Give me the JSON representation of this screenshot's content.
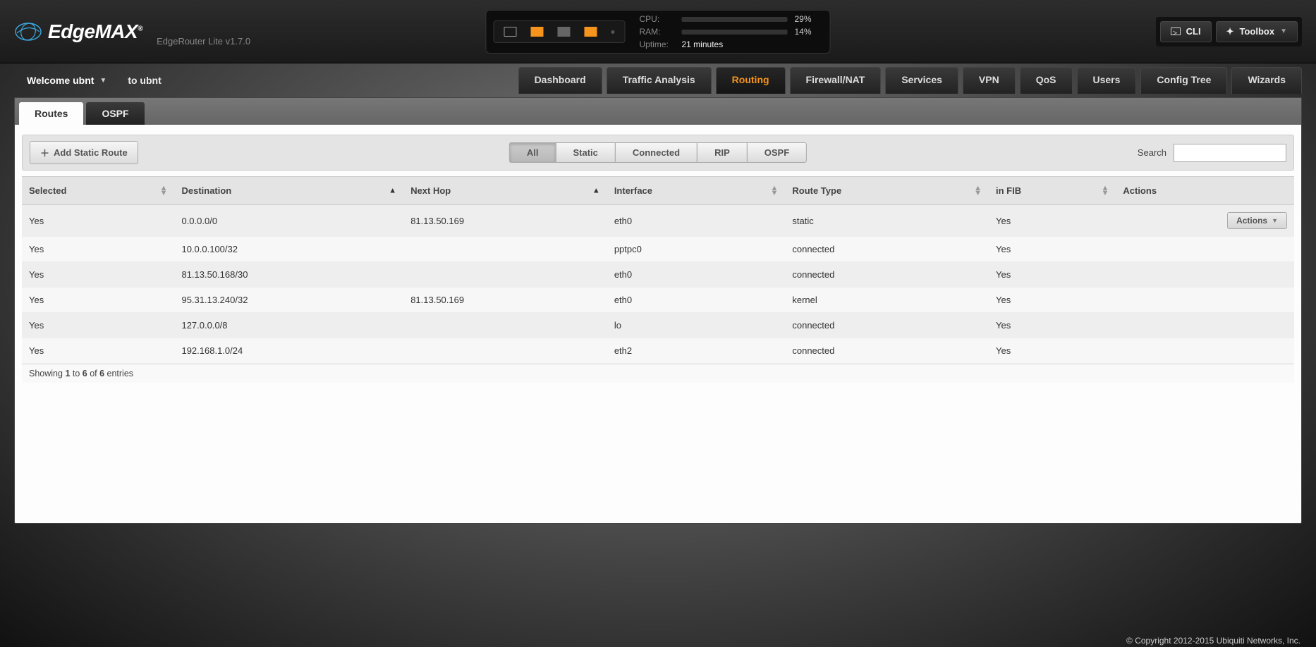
{
  "brand": {
    "name_a": "Edge",
    "name_b": "MAX",
    "subtitle": "EdgeRouter Lite v1.7.0"
  },
  "status_panel": {
    "cpu_label": "CPU:",
    "cpu_pct": 29,
    "cpu_text": "29%",
    "ram_label": "RAM:",
    "ram_pct": 14,
    "ram_text": "14%",
    "uptime_label": "Uptime:",
    "uptime_value": "21 minutes"
  },
  "header_buttons": {
    "cli": "CLI",
    "toolbox": "Toolbox"
  },
  "welcome": {
    "text": "Welcome ubnt",
    "to": "to ubnt"
  },
  "main_tabs": [
    "Dashboard",
    "Traffic Analysis",
    "Routing",
    "Firewall/NAT",
    "Services",
    "VPN",
    "QoS",
    "Users",
    "Config Tree",
    "Wizards"
  ],
  "main_tab_active": "Routing",
  "sub_tabs": [
    "Routes",
    "OSPF"
  ],
  "sub_tab_active": "Routes",
  "toolbar": {
    "add_route": "Add Static Route",
    "filters": [
      "All",
      "Static",
      "Connected",
      "RIP",
      "OSPF"
    ],
    "filter_active": "All",
    "search_label": "Search"
  },
  "columns": {
    "selected": "Selected",
    "destination": "Destination",
    "next_hop": "Next Hop",
    "interface": "Interface",
    "route_type": "Route Type",
    "in_fib": "in FIB",
    "actions": "Actions"
  },
  "rows": [
    {
      "selected": "Yes",
      "destination": "0.0.0.0/0",
      "next_hop": "81.13.50.169",
      "interface": "eth0",
      "route_type": "static",
      "in_fib": "Yes",
      "has_actions": true
    },
    {
      "selected": "Yes",
      "destination": "10.0.0.100/32",
      "next_hop": "",
      "interface": "pptpc0",
      "route_type": "connected",
      "in_fib": "Yes",
      "has_actions": false
    },
    {
      "selected": "Yes",
      "destination": "81.13.50.168/30",
      "next_hop": "",
      "interface": "eth0",
      "route_type": "connected",
      "in_fib": "Yes",
      "has_actions": false
    },
    {
      "selected": "Yes",
      "destination": "95.31.13.240/32",
      "next_hop": "81.13.50.169",
      "interface": "eth0",
      "route_type": "kernel",
      "in_fib": "Yes",
      "has_actions": false
    },
    {
      "selected": "Yes",
      "destination": "127.0.0.0/8",
      "next_hop": "",
      "interface": "lo",
      "route_type": "connected",
      "in_fib": "Yes",
      "has_actions": false
    },
    {
      "selected": "Yes",
      "destination": "192.168.1.0/24",
      "next_hop": "",
      "interface": "eth2",
      "route_type": "connected",
      "in_fib": "Yes",
      "has_actions": false
    }
  ],
  "actions_label": "Actions",
  "table_footer": {
    "prefix": "Showing ",
    "a": "1",
    "mid": " to ",
    "b": "6",
    "mid2": " of ",
    "c": "6",
    "suffix": " entries"
  },
  "copyright": "© Copyright 2012-2015 Ubiquiti Networks, Inc."
}
